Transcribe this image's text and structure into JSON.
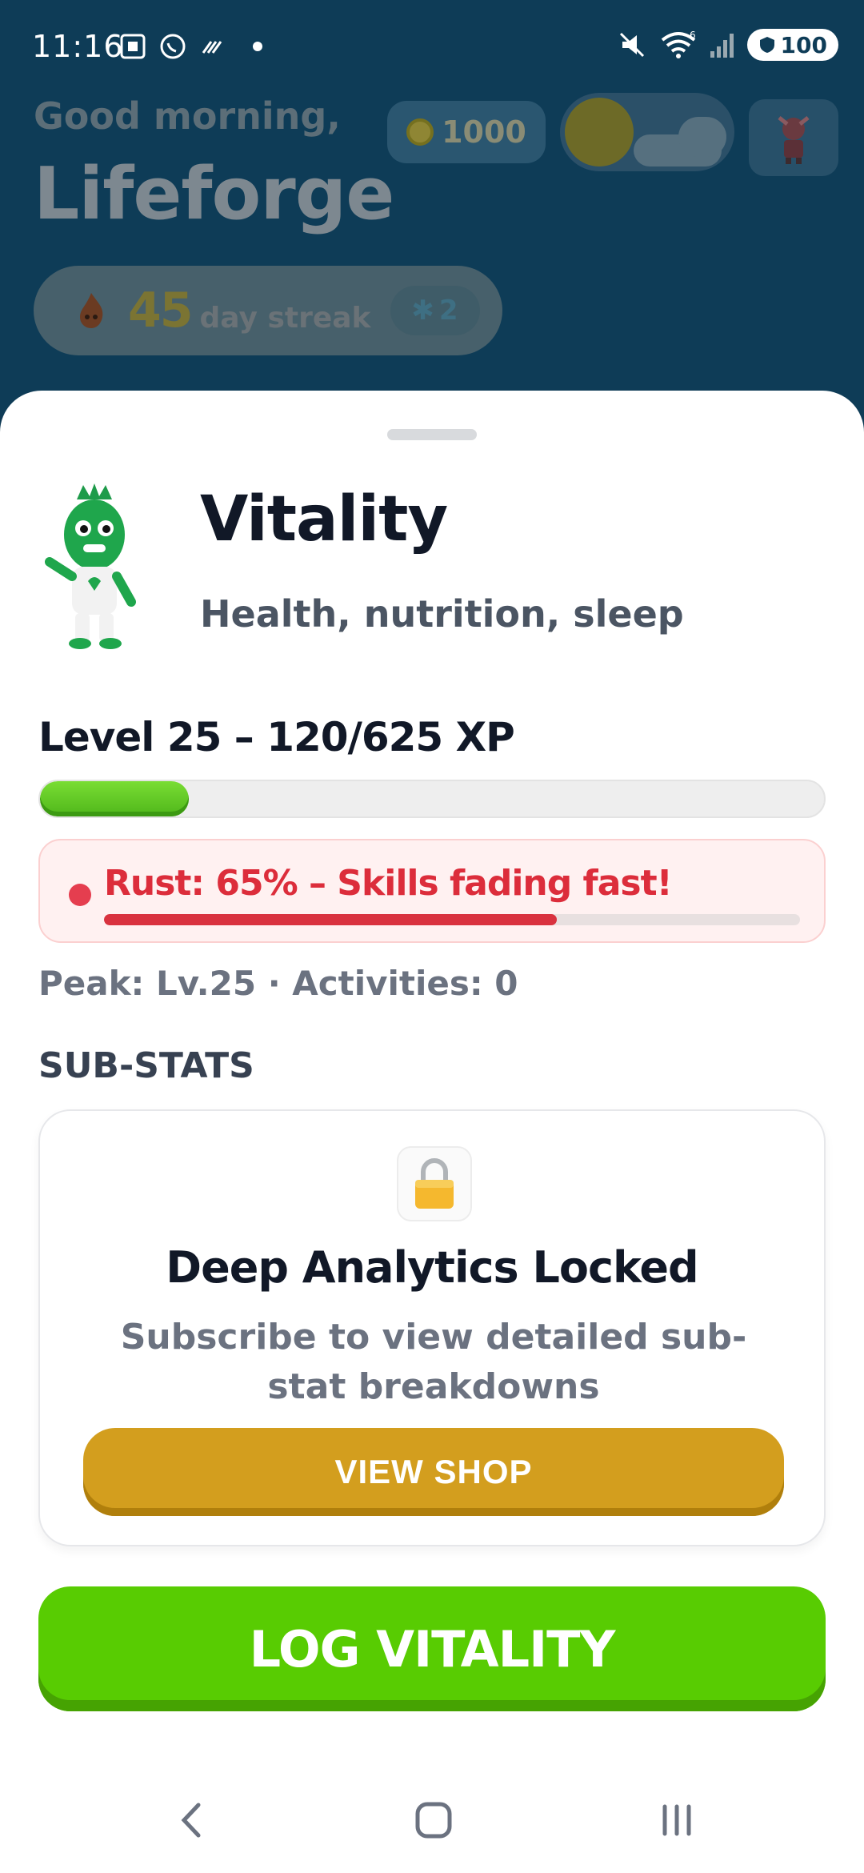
{
  "status_bar": {
    "time": "11:16",
    "battery": "100",
    "wifi_badge": "6"
  },
  "header": {
    "greeting": "Good morning,",
    "username": "Lifeforge",
    "coins": "1000",
    "streak": {
      "count": "45",
      "label": "day streak",
      "freezes": "2"
    }
  },
  "stat_sheet": {
    "title": "Vitality",
    "subtitle": "Health, nutrition, sleep",
    "level_text": "Level 25 – 120/625 XP",
    "xp_progress": 0.19,
    "rust": {
      "text": "Rust: 65% – Skills fading fast!",
      "percent": 0.65
    },
    "meta": "Peak: Lv.25 · Activities: 0",
    "section_label": "SUB-STATS",
    "locked": {
      "icon": "lock-icon",
      "title": "Deep Analytics Locked",
      "description": "Subscribe to view detailed sub-stat breakdowns",
      "button": "VIEW SHOP"
    },
    "log_button": "LOG VITALITY"
  },
  "colors": {
    "accent_green": "#58cc02",
    "rust_red": "#dc2d3b",
    "shop_gold": "#d39e1e",
    "header_bg": "#0e3c57"
  },
  "nav": {
    "back": "back-icon",
    "home": "home-icon",
    "recents": "recents-icon"
  }
}
